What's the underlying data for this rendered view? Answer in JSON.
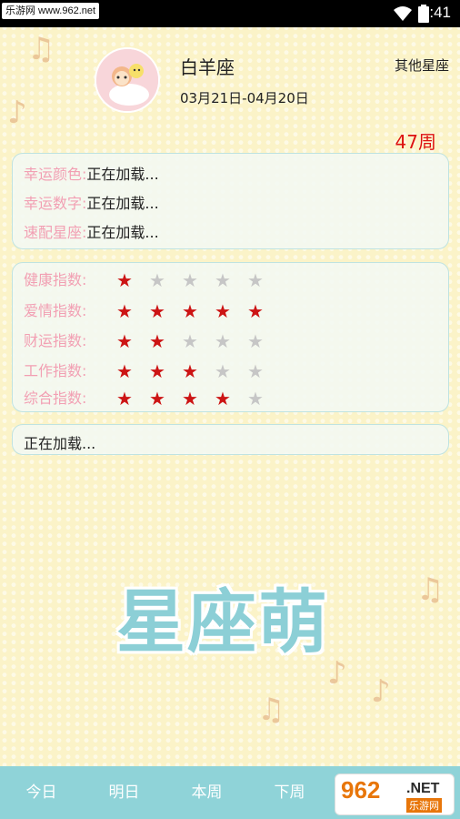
{
  "status_bar": {
    "watermark": "乐游网 www.962.net",
    "time": "4:41"
  },
  "header": {
    "sign_name": "白羊座",
    "date_range": "03月21日-04月20日",
    "other_signs_label": "其他星座",
    "week": "47周"
  },
  "lucky": {
    "items": [
      {
        "label": "幸运颜色:",
        "value": "正在加载..."
      },
      {
        "label": "幸运数字:",
        "value": "正在加载..."
      },
      {
        "label": "速配星座:",
        "value": "正在加载..."
      }
    ]
  },
  "indices": {
    "max_stars": 5,
    "items": [
      {
        "label": "健康指数:",
        "stars": 1
      },
      {
        "label": "爱情指数:",
        "stars": 5
      },
      {
        "label": "财运指数:",
        "stars": 2
      },
      {
        "label": "工作指数:",
        "stars": 3
      },
      {
        "label": "综合指数:",
        "stars": 4
      }
    ]
  },
  "summary": {
    "text": "正在加载..."
  },
  "brand_title": "星座萌",
  "tabs": [
    {
      "label": "今日"
    },
    {
      "label": "明日"
    },
    {
      "label": "本周"
    },
    {
      "label": "下周"
    }
  ],
  "watermark_logo": {
    "number": "962",
    "suffix": ".NET",
    "name": "乐游网"
  },
  "colors": {
    "label_pink": "#f29fb3",
    "star_on": "#cc1414",
    "star_off": "#c6c6c6",
    "tab_bar": "#8fd3d8",
    "week_red": "#dd1111"
  },
  "icons": [
    "wifi-icon",
    "battery-icon",
    "avatar-image",
    "star-icon"
  ]
}
